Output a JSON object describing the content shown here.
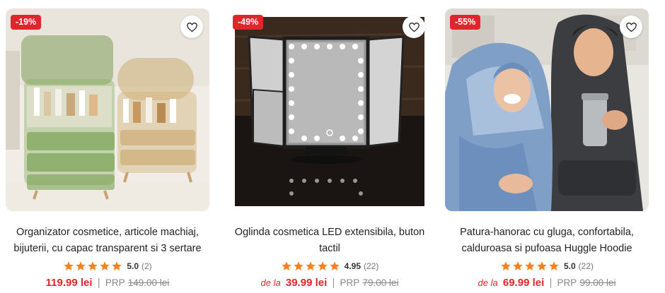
{
  "colors": {
    "accent": "#e0262d",
    "star": "#f6821f",
    "muted": "#888888"
  },
  "products": [
    {
      "discount": "-19%",
      "title_line1": "Organizator cosmetice, articole machiaj,",
      "title_line2": "bijuterii, cu capac transparent si 3 sertare",
      "rating": "5.0",
      "reviews": "(2)",
      "price_prefix": "",
      "price": "119.99 lei",
      "separator": "|",
      "prp_label": "PRP",
      "old_price": "149.00 lei",
      "image_icon": "cosmetic-organizer-image",
      "favorite_icon": "heart-icon"
    },
    {
      "discount": "-49%",
      "title_line1": "Oglinda cosmetica LED extensibila, buton",
      "title_line2": "tactil",
      "rating": "4.95",
      "reviews": "(22)",
      "price_prefix": "de la",
      "price": "39.99 lei",
      "separator": "|",
      "prp_label": "PRP",
      "old_price": "79.00 lei",
      "image_icon": "led-mirror-image",
      "favorite_icon": "heart-icon"
    },
    {
      "discount": "-55%",
      "title_line1": "Patura-hanorac cu gluga, confortabila,",
      "title_line2": "calduroasa si pufoasa Huggle Hoodie",
      "rating": "5.0",
      "reviews": "(22)",
      "price_prefix": "de la",
      "price": "69.99 lei",
      "separator": "|",
      "prp_label": "PRP",
      "old_price": "99.00 lei",
      "image_icon": "hoodie-blanket-image",
      "favorite_icon": "heart-icon"
    }
  ]
}
